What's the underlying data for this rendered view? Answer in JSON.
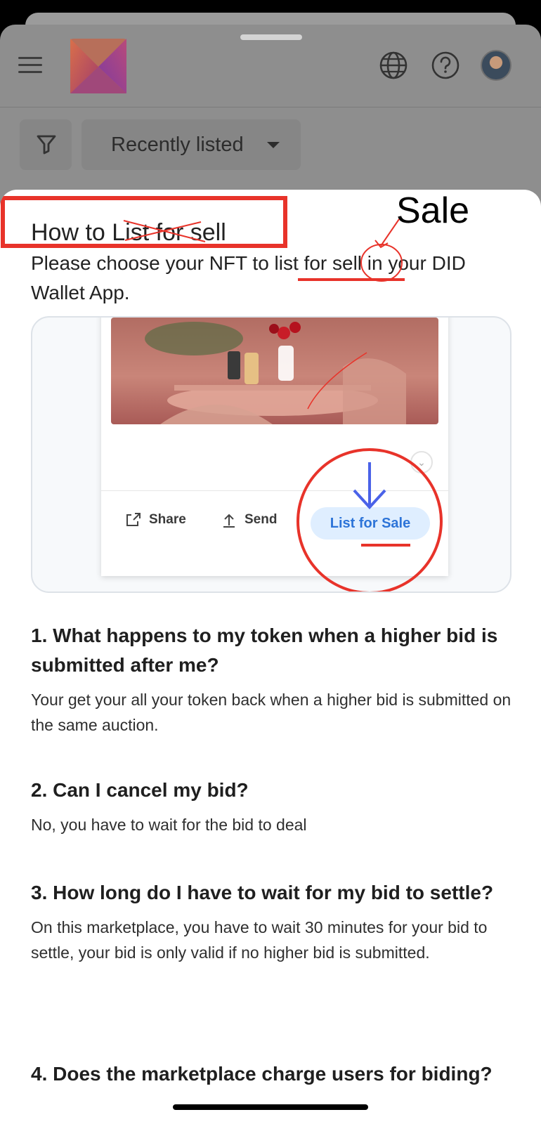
{
  "topbar": {
    "menu_icon": "hamburger-menu-icon",
    "logo_icon": "marketplace-logo",
    "language_icon": "globe-icon",
    "help_icon": "question-circle-icon",
    "avatar": "user-avatar"
  },
  "filters": {
    "filter_icon": "funnel-icon",
    "sort_label": "Recently listed"
  },
  "modal": {
    "title_prefix": "How to ",
    "title_struck": "List for",
    "title_suffix": " sell",
    "annotation_word": "Sale",
    "description": "Please choose your NFT to list for sell in your DID Wallet App.",
    "demo": {
      "share_label": "Share",
      "send_label": "Send",
      "list_label": "List for Sale"
    }
  },
  "faq": [
    {
      "question": "1. What happens to my token when a higher bid is submitted after me?",
      "answer": "Your get your all your token back when a higher bid is submitted on the same auction."
    },
    {
      "question": "2. Can I cancel my bid?",
      "answer": "No, you have to wait for the bid to deal"
    },
    {
      "question": "3. How long do I have to wait for my bid to settle?",
      "answer": "On this marketplace, you have to wait 30 minutes for your bid to settle, your bid is only valid if no higher bid is submitted."
    },
    {
      "question": "4. Does the marketplace charge users for biding?",
      "answer": ""
    }
  ],
  "colors": {
    "annotation_red": "#e8332a",
    "arrow_blue": "#4a62e8",
    "pill_blue": "#2d74d8"
  }
}
